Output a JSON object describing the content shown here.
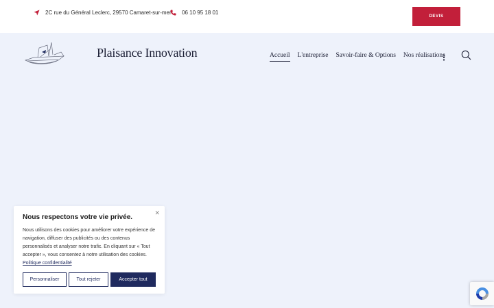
{
  "topbar": {
    "address": "2C rue du Général Leclerc, 29570 Camaret-sur-mer",
    "phone": "06 10 95 18 01",
    "devis_label": "DEVIS",
    "accent_color": "#c21f3a"
  },
  "header": {
    "site_title": "Plaisance Innovation",
    "nav": [
      {
        "label": "Accueil",
        "active": true
      },
      {
        "label": "L'entreprise",
        "active": false
      },
      {
        "label": "Savoir-faire & Options",
        "active": false
      },
      {
        "label": "Nos réalisations",
        "active": false
      }
    ]
  },
  "cookie": {
    "title": "Nous respectons votre vie privée.",
    "text": "Nous utilisons des cookies pour améliorer votre expérience de navigation, diffuser des publicités ou des contenus personnalisés et analyser notre trafic. En cliquant sur « Tout accepter », vous consentez à notre utilisation des cookies.",
    "policy_link": "Politique confidentialité",
    "customize_label": "Personnaliser",
    "reject_label": "Tout rejeter",
    "accept_label": "Accepter tout",
    "primary_color": "#1f2a5e"
  },
  "icons": {
    "address": "navigation-arrow-icon",
    "phone": "phone-icon",
    "more": "vertical-dots-icon",
    "search": "search-icon",
    "close": "close-icon",
    "recaptcha": "recaptcha-icon"
  }
}
